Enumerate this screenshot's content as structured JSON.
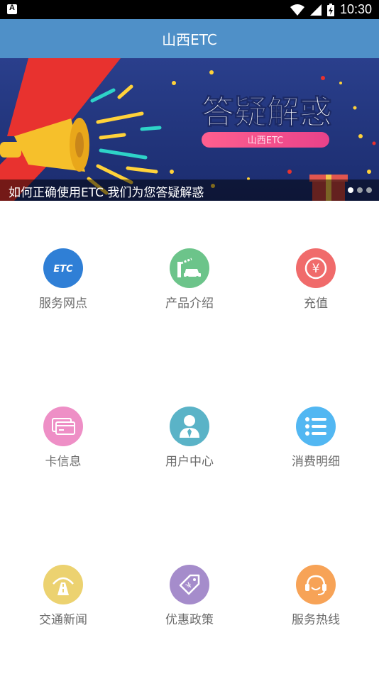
{
  "status_bar": {
    "time": "10:30"
  },
  "app_bar": {
    "title": "山西ETC"
  },
  "banner": {
    "headline": "答疑解惑",
    "badge": "山西ETC",
    "caption": "如何正确使用ETC 我们为您答疑解惑",
    "dots_total": 3,
    "active_dot": 1
  },
  "grid": [
    {
      "label": "服务网点",
      "icon": "etc-icon",
      "color": "#2f7fd6",
      "icon_text": "ETC"
    },
    {
      "label": "产品介绍",
      "icon": "toll-car-icon",
      "color": "#6cc48a"
    },
    {
      "label": "充值",
      "icon": "yen-icon",
      "color": "#f06b6b",
      "icon_text": "¥"
    },
    {
      "label": "卡信息",
      "icon": "card-icon",
      "color": "#ee8fc6"
    },
    {
      "label": "用户中心",
      "icon": "user-icon",
      "color": "#5ab3c7"
    },
    {
      "label": "消费明细",
      "icon": "list-icon",
      "color": "#52b7f2"
    },
    {
      "label": "交通新闻",
      "icon": "road-icon",
      "color": "#ecd270"
    },
    {
      "label": "优惠政策",
      "icon": "price-tag-icon",
      "color": "#a58ccb",
      "icon_text": "¥"
    },
    {
      "label": "服务热线",
      "icon": "headset-icon",
      "color": "#f7a357"
    }
  ]
}
